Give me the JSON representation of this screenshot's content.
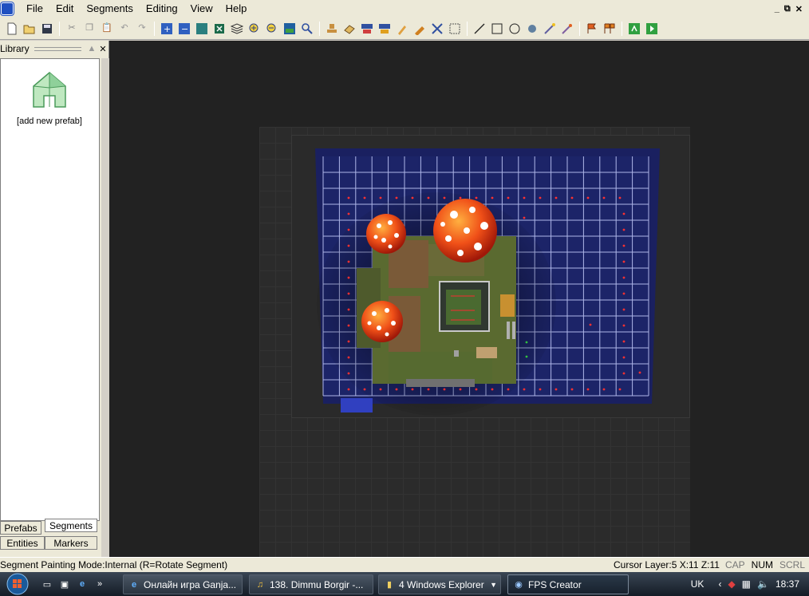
{
  "menu": {
    "items": [
      "File",
      "Edit",
      "Segments",
      "Editing",
      "View",
      "Help"
    ],
    "window_controls": [
      "_",
      "⧉",
      "✕"
    ]
  },
  "toolbar": {
    "groups": [
      [
        "new-icon",
        "open-icon",
        "save-icon"
      ],
      [
        "cut-icon",
        "copy-icon",
        "paste-icon",
        "undo-icon",
        "redo-icon"
      ],
      [
        "add-layer-icon",
        "remove-layer-icon",
        "view-icon",
        "cross-icon",
        "layers-icon",
        "zoom-in-icon",
        "zoom-out-icon",
        "map-icon",
        "search-icon"
      ],
      [
        "stamp-icon",
        "eraser-icon",
        "paint-icon",
        "picker-icon",
        "brush-icon",
        "spray-icon",
        "select-icon",
        "grid-icon"
      ],
      [
        "line-icon",
        "rectangle-icon",
        "circle-icon",
        "entity-icon",
        "wand-icon",
        "light-icon"
      ],
      [
        "flag-icon",
        "flags-icon"
      ],
      [
        "test-game-icon",
        "build-game-icon"
      ]
    ]
  },
  "library": {
    "title": "Library",
    "prefab_label": "[add new prefab]",
    "tabs": [
      "Prefabs",
      "Segments",
      "Entities",
      "Markers"
    ]
  },
  "status": {
    "mode": "Segment Painting Mode:Internal (R=Rotate Segment)",
    "cursor": "Cursor Layer:5  X:11  Z:11",
    "keys": [
      "CAP",
      "NUM",
      "SCRL"
    ]
  },
  "taskbar": {
    "tasks": [
      {
        "label": "Онлайн игра Ganja...",
        "icon": "browser-icon"
      },
      {
        "label": "138. Dimmu Borgir -...",
        "icon": "media-icon"
      },
      {
        "label": "4 Windows Explorer",
        "icon": "folder-icon"
      },
      {
        "label": "FPS Creator",
        "icon": "app-icon"
      }
    ],
    "language": "UK",
    "time": "18:37"
  }
}
